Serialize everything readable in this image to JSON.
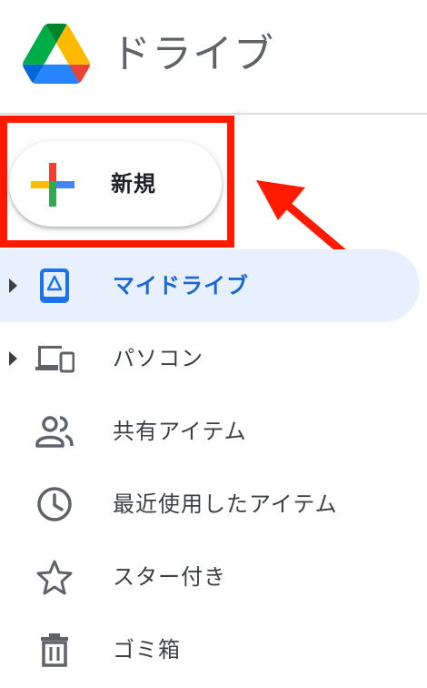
{
  "header": {
    "app_title": "ドライブ"
  },
  "new_button": {
    "label": "新規",
    "icon": "plus-icon"
  },
  "nav": {
    "items": [
      {
        "label": "マイドライブ",
        "icon": "my-drive-icon",
        "expandable": true,
        "active": true
      },
      {
        "label": "パソコン",
        "icon": "computers-icon",
        "expandable": true,
        "active": false
      },
      {
        "label": "共有アイテム",
        "icon": "people-icon",
        "expandable": false,
        "active": false
      },
      {
        "label": "最近使用したアイテム",
        "icon": "clock-icon",
        "expandable": false,
        "active": false
      },
      {
        "label": "スター付き",
        "icon": "star-icon",
        "expandable": false,
        "active": false
      },
      {
        "label": "ゴミ箱",
        "icon": "trash-icon",
        "expandable": false,
        "active": false
      }
    ]
  },
  "annotation": {
    "highlight_color": "#ff1a00"
  },
  "colors": {
    "active_bg": "#e8f0fe",
    "active_text": "#1967d2",
    "text": "#3c4043",
    "icon": "#5f6368"
  }
}
